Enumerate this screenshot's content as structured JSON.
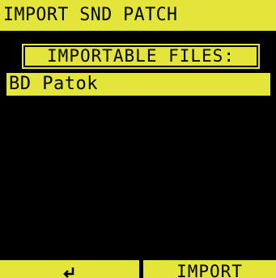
{
  "title": "IMPORT SND PATCH",
  "list_header": "IMPORTABLE FILES:",
  "files": [
    {
      "label": "BD Patok",
      "selected": true
    }
  ],
  "softkeys": {
    "left_icon": "back-arrow-icon",
    "right_label": "IMPORT"
  },
  "colors": {
    "accent": "#e3e639",
    "background": "#000000"
  }
}
